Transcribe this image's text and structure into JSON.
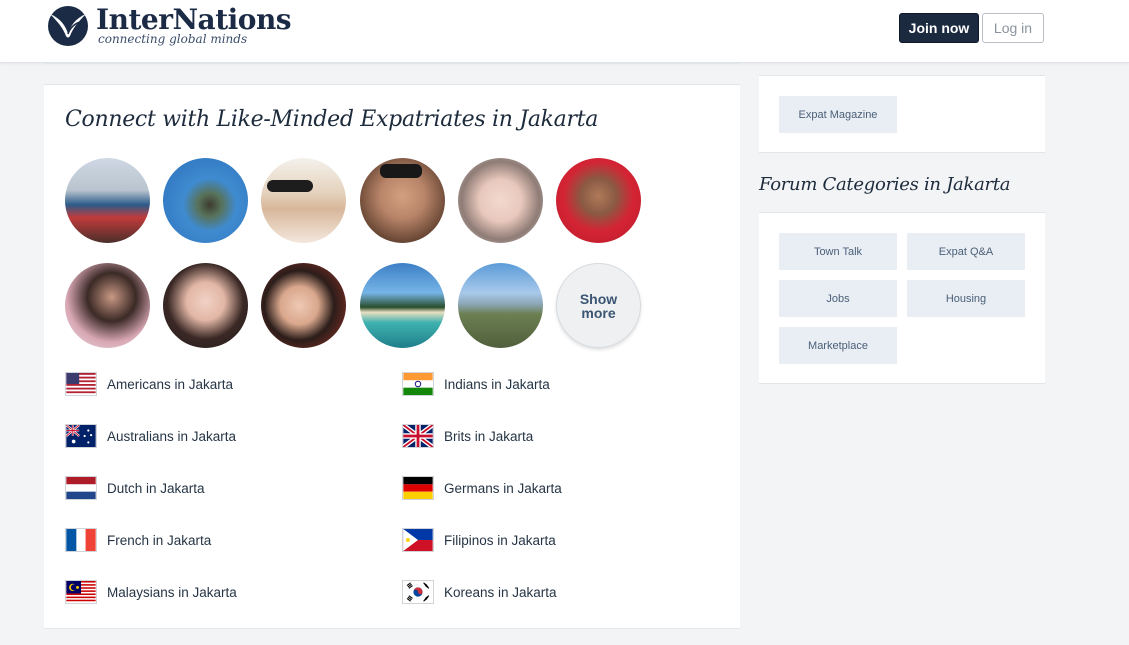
{
  "header": {
    "logo_name": "InterNations",
    "logo_tagline": "connecting global minds",
    "join_label": "Join now",
    "login_label": "Log in"
  },
  "main": {
    "title": "Connect with Like-Minded Expatriates in Jakarta",
    "show_more": [
      "Show",
      "more"
    ],
    "nationalities": [
      {
        "label": "Americans in Jakarta",
        "flag": "us-flag-icon"
      },
      {
        "label": "Indians in Jakarta",
        "flag": "india-flag-icon"
      },
      {
        "label": "Australians in Jakarta",
        "flag": "australia-flag-icon"
      },
      {
        "label": "Brits in Jakarta",
        "flag": "uk-flag-icon"
      },
      {
        "label": "Dutch in Jakarta",
        "flag": "netherlands-flag-icon"
      },
      {
        "label": "Germans in Jakarta",
        "flag": "germany-flag-icon"
      },
      {
        "label": "French in Jakarta",
        "flag": "france-flag-icon"
      },
      {
        "label": "Filipinos in Jakarta",
        "flag": "philippines-flag-icon"
      },
      {
        "label": "Malaysians in Jakarta",
        "flag": "malaysia-flag-icon"
      },
      {
        "label": "Koreans in Jakarta",
        "flag": "korea-flag-icon"
      }
    ]
  },
  "sidebar": {
    "magazine_label": "Expat Magazine",
    "forum_title": "Forum Categories in Jakarta",
    "categories": [
      "Town Talk",
      "Expat Q&A",
      "Jobs",
      "Housing",
      "Marketplace"
    ]
  },
  "colors": {
    "brand_navy": "#1c2a40",
    "chip_bg": "#e9eef4",
    "page_bg": "#f3f4f5"
  }
}
